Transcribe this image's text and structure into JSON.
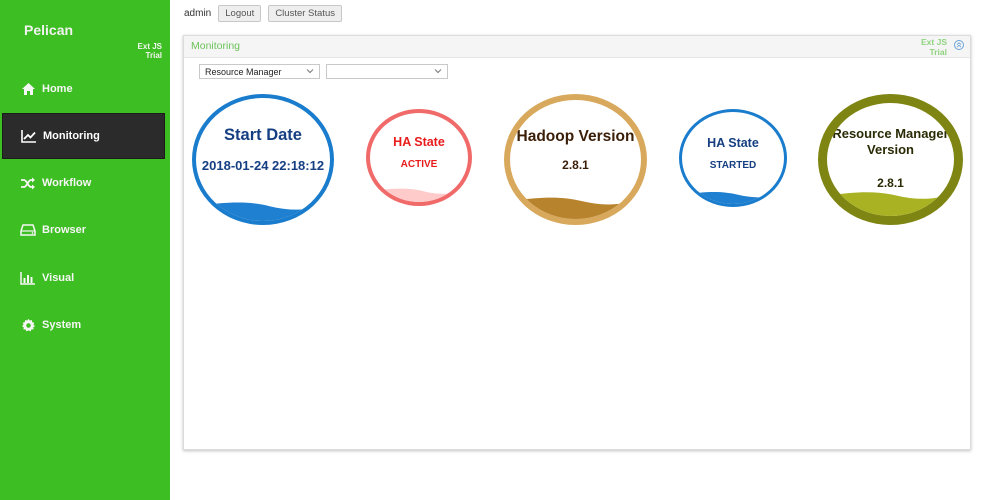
{
  "sidebar": {
    "brand": "Pelican",
    "trial": [
      "Ext JS",
      "Trial"
    ],
    "items": [
      {
        "label": "Home",
        "icon": "home-icon"
      },
      {
        "label": "Monitoring",
        "icon": "line-chart-icon"
      },
      {
        "label": "Workflow",
        "icon": "shuffle-icon"
      },
      {
        "label": "Browser",
        "icon": "drive-icon"
      },
      {
        "label": "Visual",
        "icon": "bar-chart-icon"
      },
      {
        "label": "System",
        "icon": "gear-icon"
      }
    ],
    "active_index": 1
  },
  "topbar": {
    "user": "admin",
    "logout_label": "Logout",
    "cluster_status_label": "Cluster Status"
  },
  "panel": {
    "title": "Monitoring",
    "trial": [
      "Ext JS",
      "Trial"
    ],
    "select1_value": "Resource Manager",
    "select2_value": ""
  },
  "gauges": [
    {
      "title": "Start Date",
      "value": "2018-01-24 22:18:12",
      "color": "#1a7ccc",
      "title_color": "#153f82",
      "value_color": "#153f82",
      "fill_color": "#1f7fd0",
      "level": 0.12
    },
    {
      "title": "HA State",
      "value": "ACTIVE",
      "color": "#f06a6a",
      "title_color": "#e81c1c",
      "value_color": "#e81c1c",
      "fill_color": "#ffcaca",
      "level": 0.12
    },
    {
      "title": "Hadoop Version",
      "value": "2.8.1",
      "color": "#d8a95c",
      "title_color": "#3a1e08",
      "value_color": "#3a1e08",
      "fill_color": "#b8832d",
      "level": 0.15
    },
    {
      "title": "HA State",
      "value": "STARTED",
      "color": "#1a7ccc",
      "title_color": "#153f82",
      "value_color": "#153f82",
      "fill_color": "#1f7fd0",
      "level": 0.1
    },
    {
      "title": [
        "Resource Manager",
        "Version"
      ],
      "value": "2.8.1",
      "color": "#7f8512",
      "title_color": "#2a2a05",
      "value_color": "#2a2a05",
      "fill_color": "#a9b223",
      "level": 0.18
    }
  ]
}
